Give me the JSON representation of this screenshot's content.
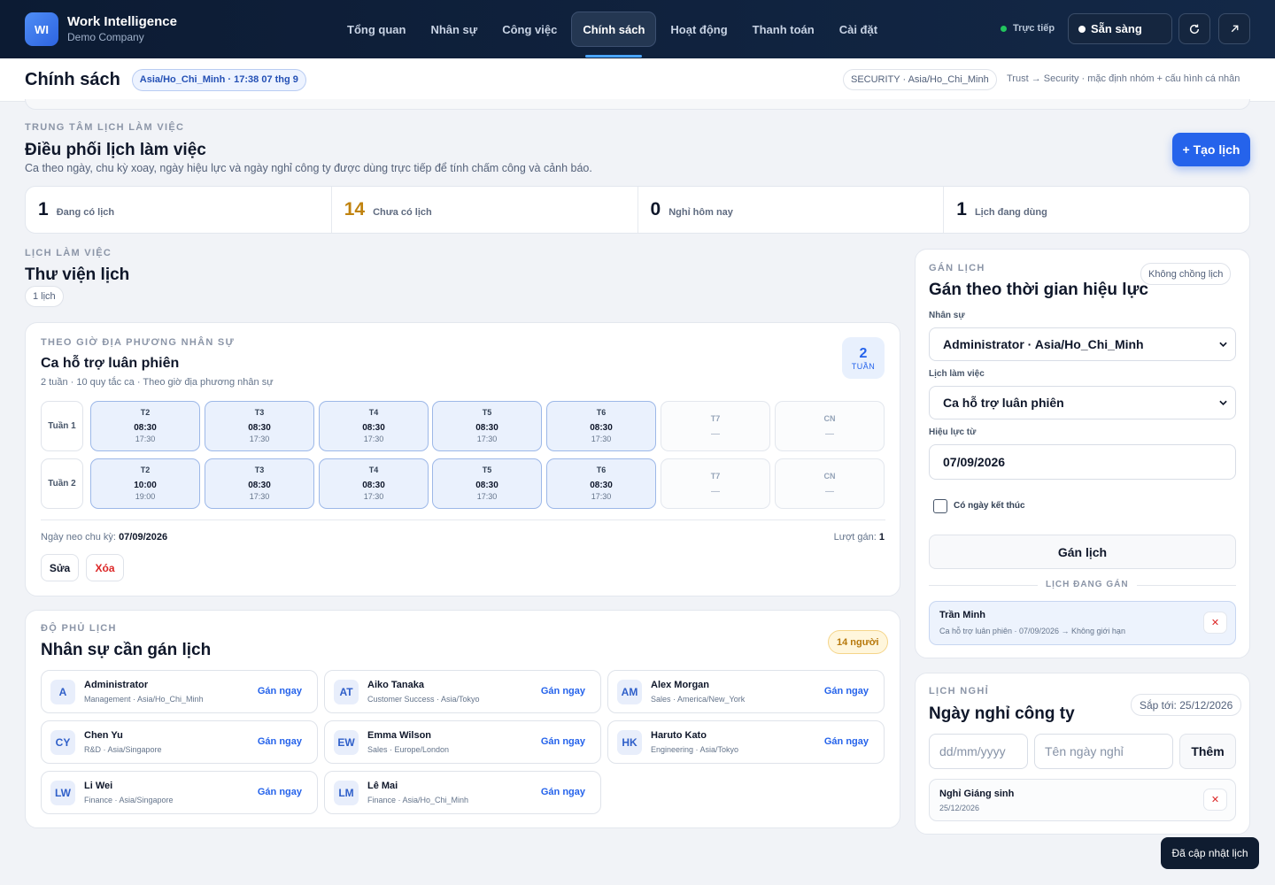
{
  "brand": {
    "logo": "WI",
    "name": "Work Intelligence",
    "company": "Demo Company"
  },
  "nav": {
    "tabs": [
      "Tổng quan",
      "Nhân sự",
      "Công việc",
      "Chính sách",
      "Hoạt động",
      "Thanh toán",
      "Cài đặt"
    ],
    "active": "Chính sách"
  },
  "header_status": {
    "live": "Trực tiếp",
    "ready": "Sẵn sàng",
    "refresh_icon": "refresh-icon",
    "external_icon": "external-link-icon"
  },
  "subbar": {
    "title": "Chính sách",
    "timezone": "Asia/Ho_Chi_Minh · 17:38 07 thg 9",
    "security": "SECURITY · Asia/Ho_Chi_Minh",
    "trust": "Trust → Security · mặc định nhóm + cấu hình cá nhân"
  },
  "center": {
    "eyebrow": "TRUNG TÂM LỊCH LÀM VIỆC",
    "title": "Điều phối lịch làm việc",
    "desc": "Ca theo ngày, chu kỳ xoay, ngày hiệu lực và ngày nghỉ công ty được dùng trực tiếp để tính chấm công và cảnh báo.",
    "create": "+ Tạo lịch"
  },
  "stats": [
    {
      "value": "1",
      "label": "Đang có lịch",
      "color": "#0f172a"
    },
    {
      "value": "14",
      "label": "Chưa có lịch",
      "color": "#c0830f"
    },
    {
      "value": "0",
      "label": "Nghỉ hôm nay",
      "color": "#0f172a"
    },
    {
      "value": "1",
      "label": "Lịch đang dùng",
      "color": "#0f172a"
    }
  ],
  "library": {
    "eyebrow": "LỊCH LÀM VIỆC",
    "title": "Thư viện lịch",
    "count": "1 lịch"
  },
  "schedule": {
    "eyebrow": "THEO GIỜ ĐỊA PHƯƠNG NHÂN SỰ",
    "name": "Ca hỗ trợ luân phiên",
    "meta": "2 tuần · 10 quy tắc ca · Theo giờ địa phương nhân sự",
    "cycle_value": "2",
    "cycle_unit": "TUẦN",
    "weeks": [
      {
        "label": "Tuần 1",
        "days": [
          {
            "d": "T2",
            "s": "08:30",
            "e": "17:30",
            "on": true
          },
          {
            "d": "T3",
            "s": "08:30",
            "e": "17:30",
            "on": true
          },
          {
            "d": "T4",
            "s": "08:30",
            "e": "17:30",
            "on": true
          },
          {
            "d": "T5",
            "s": "08:30",
            "e": "17:30",
            "on": true
          },
          {
            "d": "T6",
            "s": "08:30",
            "e": "17:30",
            "on": true
          },
          {
            "d": "T7",
            "s": "—",
            "e": "",
            "on": false
          },
          {
            "d": "CN",
            "s": "—",
            "e": "",
            "on": false
          }
        ]
      },
      {
        "label": "Tuần 2",
        "days": [
          {
            "d": "T2",
            "s": "10:00",
            "e": "19:00",
            "on": true
          },
          {
            "d": "T3",
            "s": "08:30",
            "e": "17:30",
            "on": true
          },
          {
            "d": "T4",
            "s": "08:30",
            "e": "17:30",
            "on": true
          },
          {
            "d": "T5",
            "s": "08:30",
            "e": "17:30",
            "on": true
          },
          {
            "d": "T6",
            "s": "08:30",
            "e": "17:30",
            "on": true
          },
          {
            "d": "T7",
            "s": "—",
            "e": "",
            "on": false
          },
          {
            "d": "CN",
            "s": "—",
            "e": "",
            "on": false
          }
        ]
      }
    ],
    "anchor_label": "Ngày neo chu kỳ:",
    "anchor_value": "07/09/2026",
    "assign_label": "Lượt gán:",
    "assign_value": "1",
    "edit": "Sửa",
    "delete": "Xóa"
  },
  "coverage": {
    "eyebrow": "ĐỘ PHỦ LỊCH",
    "title": "Nhân sự cần gán lịch",
    "badge": "14 người",
    "action": "Gán ngay",
    "employees": [
      {
        "init": "A",
        "name": "Administrator",
        "meta": "Management · Asia/Ho_Chi_Minh"
      },
      {
        "init": "AT",
        "name": "Aiko Tanaka",
        "meta": "Customer Success · Asia/Tokyo"
      },
      {
        "init": "AM",
        "name": "Alex Morgan",
        "meta": "Sales · America/New_York"
      },
      {
        "init": "CY",
        "name": "Chen Yu",
        "meta": "R&D · Asia/Singapore"
      },
      {
        "init": "EW",
        "name": "Emma Wilson",
        "meta": "Sales · Europe/London"
      },
      {
        "init": "HK",
        "name": "Haruto Kato",
        "meta": "Engineering · Asia/Tokyo"
      },
      {
        "init": "LW",
        "name": "Li Wei",
        "meta": "Finance · Asia/Singapore"
      },
      {
        "init": "LM",
        "name": "Lê Mai",
        "meta": "Finance · Asia/Ho_Chi_Minh"
      }
    ]
  },
  "assign": {
    "eyebrow": "GÁN LỊCH",
    "title": "Gán theo thời gian hiệu lực",
    "no_overlap": "Không chồng lịch",
    "employee_label": "Nhân sự",
    "employee_value": "Administrator · Asia/Ho_Chi_Minh",
    "schedule_label": "Lịch làm việc",
    "schedule_value": "Ca hỗ trợ luân phiên",
    "from_label": "Hiệu lực từ",
    "from_value": "07/09/2026",
    "end_checkbox": "Có ngày kết thúc",
    "submit": "Gán lịch",
    "current_heading": "LỊCH ĐANG GÁN",
    "current_name": "Trần Minh",
    "current_meta": "Ca hỗ trợ luân phiên · 07/09/2026 → Không giới hạn"
  },
  "holidays": {
    "eyebrow": "LỊCH NGHỈ",
    "title": "Ngày nghỉ công ty",
    "upcoming": "Sắp tới: 25/12/2026",
    "date_placeholder": "dd/mm/yyyy",
    "name_placeholder": "Tên ngày nghỉ",
    "add": "Thêm",
    "item_name": "Nghỉ Giáng sinh",
    "item_date": "25/12/2026"
  },
  "toast": "Đã cập nhật lịch"
}
